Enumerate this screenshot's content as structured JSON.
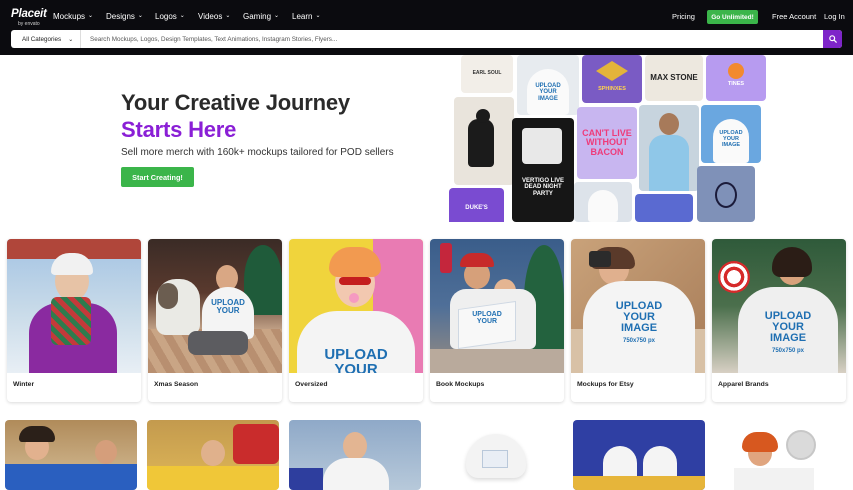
{
  "nav": {
    "logo_text": "Placeit",
    "logo_sub": "by envato",
    "menu": [
      {
        "label": "Mockups"
      },
      {
        "label": "Designs"
      },
      {
        "label": "Logos"
      },
      {
        "label": "Videos"
      },
      {
        "label": "Gaming"
      },
      {
        "label": "Learn"
      }
    ],
    "pricing": "Pricing",
    "unlimited": "Go Unlimited!",
    "free_account": "Free Account",
    "login": "Log In"
  },
  "search": {
    "category": "All Categories",
    "placeholder": "Search Mockups, Logos, Design Templates, Text Animations, Instagram Stories, Flyers..."
  },
  "hero": {
    "title_line1": "Your Creative Journey",
    "title_line2": "Starts Here",
    "subtitle": "Sell more merch with 160k+ mockups tailored for POD sellers",
    "cta": "Start Creating!"
  },
  "collage_text": {
    "t1": "EARL SOUL",
    "t2": "UPLOAD YOUR IMAGE",
    "t3": "SPHINXES",
    "t4": "MAX STONE",
    "t5": "TINES",
    "t6": "CAN'T LIVE WITHOUT BACON",
    "t7": "VERTIGO LIVE DEAD NIGHT PARTY",
    "t8": "UPLOAD YOUR IMAGE",
    "t9": "DUKE'S"
  },
  "categories": [
    {
      "label": "Winter"
    },
    {
      "label": "Xmas Season"
    },
    {
      "label": "Oversized"
    },
    {
      "label": "Book Mockups"
    },
    {
      "label": "Mockups for Etsy"
    },
    {
      "label": "Apparel Brands"
    }
  ],
  "print_text": {
    "upload": "UPLOAD",
    "your": "YOUR",
    "image": "IMAGE",
    "size": "750x750 px"
  },
  "colors": {
    "nav_bg": "#0b0b0f",
    "accent_purple": "#8a1fd6",
    "cta_green": "#3bb54a",
    "search_btn": "#7e25c9"
  }
}
